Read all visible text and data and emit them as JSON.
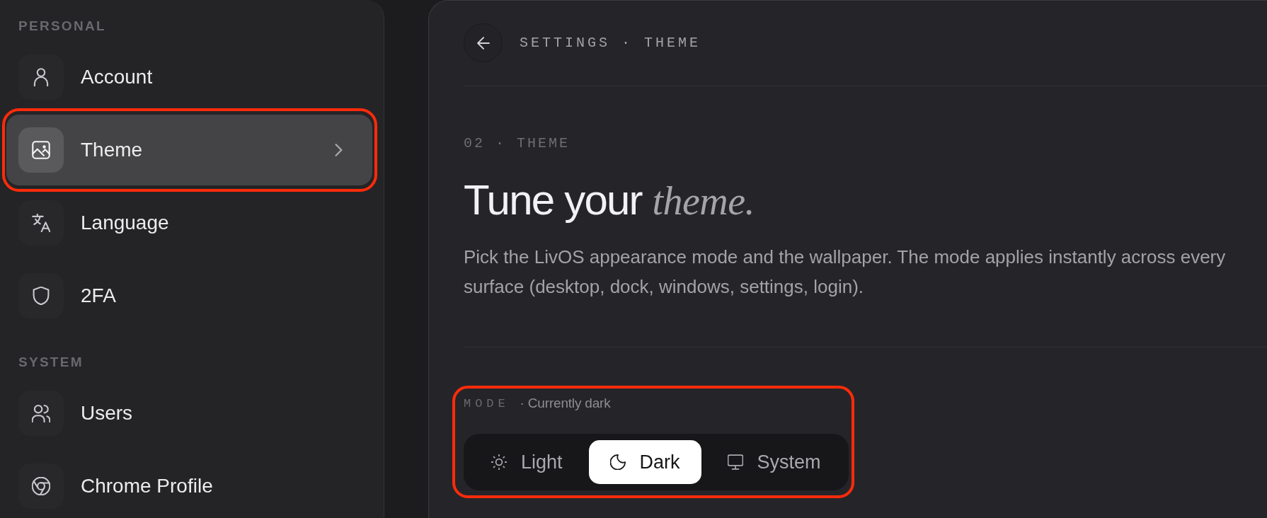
{
  "sidebar": {
    "sections": [
      {
        "heading": "PERSONAL",
        "items": [
          {
            "label": "Account",
            "selected": false,
            "highlighted": false
          },
          {
            "label": "Theme",
            "selected": true,
            "highlighted": true
          },
          {
            "label": "Language",
            "selected": false,
            "highlighted": false
          },
          {
            "label": "2FA",
            "selected": false,
            "highlighted": false
          }
        ]
      },
      {
        "heading": "SYSTEM",
        "items": [
          {
            "label": "Users",
            "selected": false,
            "highlighted": false
          },
          {
            "label": "Chrome Profile",
            "selected": false,
            "highlighted": false
          }
        ]
      }
    ]
  },
  "header": {
    "breadcrumb": "SETTINGS · THEME"
  },
  "intro": {
    "eyebrow": "02 · THEME",
    "title": "Tune your *theme.*",
    "description": "Pick the LivOS appearance mode and the wallpaper. The mode applies instantly across every surface (desktop, dock, windows, settings, login)."
  },
  "mode": {
    "label": "MODE",
    "status": "· Currently dark",
    "highlighted": true,
    "options": [
      {
        "label": "Light",
        "selected": false
      },
      {
        "label": "Dark",
        "selected": true
      },
      {
        "label": "System",
        "selected": false
      }
    ]
  }
}
